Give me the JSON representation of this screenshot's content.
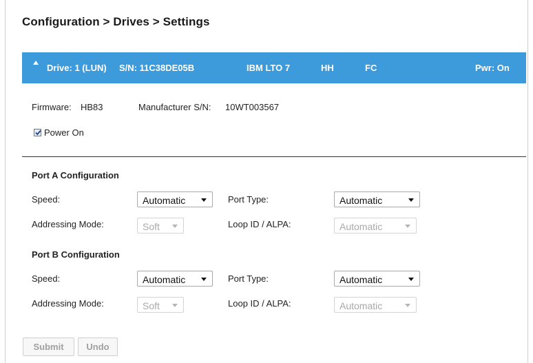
{
  "breadcrumb": "Configuration > Drives > Settings",
  "drive_bar": {
    "drive": "Drive: 1 (LUN)",
    "serial": "S/N: 11C38DE05B",
    "model": "IBM LTO 7",
    "form_factor": "HH",
    "interface": "FC",
    "power": "Pwr: On",
    "color": "#3d9bdb"
  },
  "info": {
    "firmware_label": "Firmware:",
    "firmware_value": "HB83",
    "mfr_sn_label": "Manufacturer S/N:",
    "mfr_sn_value": "10WT003567"
  },
  "power_on": {
    "label": "Power On",
    "checked": true
  },
  "port_a": {
    "title": "Port A Configuration",
    "speed_label": "Speed:",
    "speed_value": "Automatic",
    "port_type_label": "Port Type:",
    "port_type_value": "Automatic",
    "addressing_label": "Addressing Mode:",
    "addressing_value": "Soft",
    "loop_label": "Loop ID / ALPA:",
    "loop_value": "Automatic"
  },
  "port_b": {
    "title": "Port B Configuration",
    "speed_label": "Speed:",
    "speed_value": "Automatic",
    "port_type_label": "Port Type:",
    "port_type_value": "Automatic",
    "addressing_label": "Addressing Mode:",
    "addressing_value": "Soft",
    "loop_label": "Loop ID / ALPA:",
    "loop_value": "Automatic"
  },
  "buttons": {
    "submit": "Submit",
    "undo": "Undo"
  }
}
